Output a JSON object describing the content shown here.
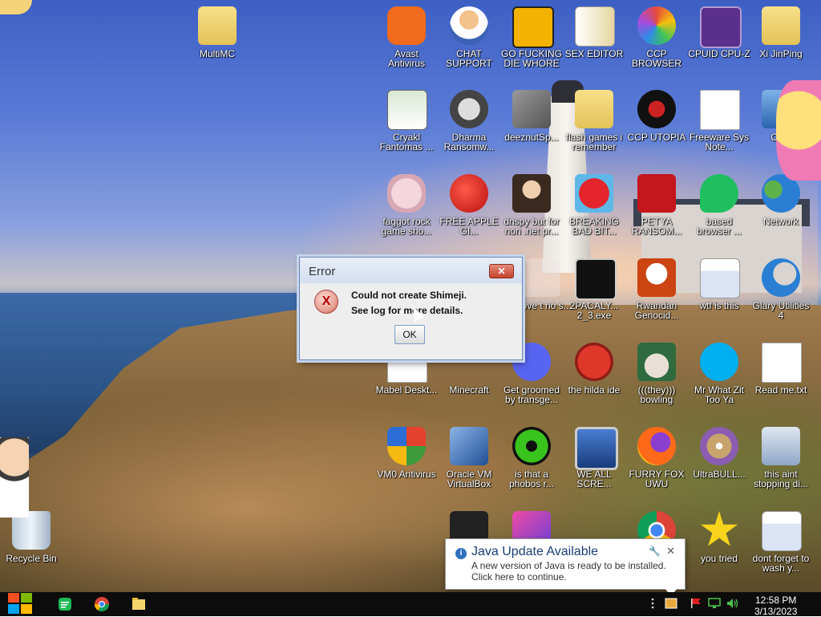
{
  "desktop_icons": [
    {
      "label": "MultiMC",
      "icon": "folder-icon"
    },
    {
      "label": "Avast Antivirus",
      "icon": "avast-icon"
    },
    {
      "label": "CHAT SUPPORT",
      "icon": "doctor-icon"
    },
    {
      "label": "GO FUCKING DIE WHORE",
      "icon": "de-icon"
    },
    {
      "label": "SEX EDITOR",
      "icon": "hxd-icon"
    },
    {
      "label": "CCP BROWSER",
      "icon": "browser-icon"
    },
    {
      "label": "CPUID CPU-Z",
      "icon": "cpuz-icon"
    },
    {
      "label": "Xi JinPing",
      "icon": "folder-user-icon"
    },
    {
      "label": "Cryakl Fantomas ...",
      "icon": "window-app-icon"
    },
    {
      "label": "Dharma Ransomw...",
      "icon": "skull-icon"
    },
    {
      "label": "deeznutSp...",
      "icon": "stacked-windows-icon"
    },
    {
      "label": "flash games i remember",
      "icon": "folder-icon"
    },
    {
      "label": "CCP UTOPIA",
      "icon": "dragon-icon"
    },
    {
      "label": "Freeware Sys Note...",
      "icon": "document-icon"
    },
    {
      "label": "Co...",
      "icon": "computer-icon"
    },
    {
      "label": "faggot rock game sho...",
      "icon": "pig-icon"
    },
    {
      "label": "FREE APPLE GI...",
      "icon": "apple-icon"
    },
    {
      "label": "dnspy but for non .net pr...",
      "icon": "portrait-icon"
    },
    {
      "label": "BREAKING BAD BIT...",
      "icon": "angry-bird-icon"
    },
    {
      "label": "PETYA RANSOM...",
      "icon": "red-skull-icon"
    },
    {
      "label": "based browser ...",
      "icon": "chat-bubble-icon"
    },
    {
      "label": "Network",
      "icon": "network-icon"
    },
    {
      "label": "above t no s...",
      "icon": "x64-icon"
    },
    {
      "label": "2PACALY... 2_3.exe",
      "icon": "console-icon"
    },
    {
      "label": "Rwandan Genocid...",
      "icon": "meme-icon"
    },
    {
      "label": "wtf is this",
      "icon": "calendar-doc-icon"
    },
    {
      "label": "Glary Utilities 4",
      "icon": "moon-icon"
    },
    {
      "label": "Mabel Deskt...",
      "icon": "document-icon"
    },
    {
      "label": "Minecraft",
      "icon": "minecraft-icon"
    },
    {
      "label": "Get groomed by transge...",
      "icon": "discord-icon"
    },
    {
      "label": "the hilda ide",
      "icon": "devcpp-icon"
    },
    {
      "label": "(((they))) bowling",
      "icon": "santa-icon"
    },
    {
      "label": "Mr What Zit Too Ya",
      "icon": "skype-icon"
    },
    {
      "label": "Read me.txt",
      "icon": "text-file-icon"
    },
    {
      "label": "VM0 Antivirus",
      "icon": "shield-icon"
    },
    {
      "label": "Oracle VM VirtualBox",
      "icon": "virtualbox-icon"
    },
    {
      "label": "is that a phobos r...",
      "icon": "flower-icon"
    },
    {
      "label": "WE ALL SCRE...",
      "icon": "monitor-icon"
    },
    {
      "label": "FURRY FOX UWU",
      "icon": "firefox-icon"
    },
    {
      "label": "UltraBULL...",
      "icon": "disc-icon"
    },
    {
      "label": "this aint stopping di...",
      "icon": "pc-network-icon"
    },
    {
      "label": "",
      "icon": "skull-dark-icon"
    },
    {
      "label": "",
      "icon": "image-app-icon"
    },
    {
      "label": "",
      "icon": "vlc-icon"
    },
    {
      "label": "",
      "icon": "chrome-icon"
    },
    {
      "label": "you tried",
      "icon": "star-icon"
    },
    {
      "label": "dont forget to wash y...",
      "icon": "calendar-doc-icon"
    },
    {
      "label": "Recycle Bin",
      "icon": "recycle-bin-icon"
    }
  ],
  "error_dialog": {
    "title": "Error",
    "close_label": "✕",
    "icon_glyph": "X",
    "message_line1": "Could not create Shimeji.",
    "message_line2": "See log for more details.",
    "ok_label": "OK"
  },
  "java_notification": {
    "info_glyph": "i",
    "title": "Java Update Available",
    "line1": "A new version of Java is ready to be installed.",
    "line2": "Click here to continue.",
    "close_label": "✕",
    "settings_label": "🔧"
  },
  "taskbar": {
    "clock_time": "12:58 PM",
    "clock_date": "3/13/2023",
    "pinned": [
      "spotify-icon",
      "chrome-icon",
      "file-explorer-icon"
    ],
    "tray": [
      "overflow-icon",
      "java-update-icon",
      "flag-icon",
      "network-tray-icon",
      "volume-icon"
    ]
  },
  "colors": {
    "taskbar_bg": "#0c0c0c",
    "dialog_close_red": "#c5412c",
    "java_title_blue": "#1b3d7a",
    "windows_logo": [
      "#f25022",
      "#7fba00",
      "#00a4ef",
      "#ffb900"
    ]
  }
}
